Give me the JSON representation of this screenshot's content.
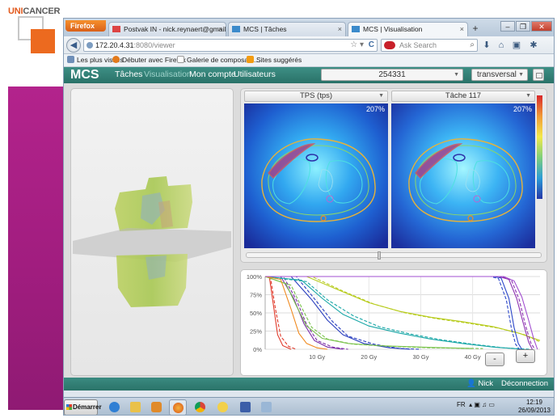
{
  "slide": {
    "logo_uni": "UNI",
    "logo_cancer": "CANCER"
  },
  "browser": {
    "firefox_menu": "Firefox",
    "tabs": [
      {
        "label": "Postvak IN - nick.reynaert@gmail.com - ..."
      },
      {
        "label": "MCS | Tâches"
      },
      {
        "label": "MCS | Visualisation"
      }
    ],
    "url_host": "172.20.4.31",
    "url_rest": ":8080/viewer",
    "search_placeholder": "Ask Search",
    "bookmarks": [
      "Les plus visités",
      "Débuter avec Firefox",
      "Galerie de composant...",
      "Sites suggérés"
    ]
  },
  "app": {
    "brand": "MCS",
    "nav": [
      "Tâches",
      "Visualisation",
      "Mon compte",
      "Utilisateurs"
    ],
    "active_nav": "Visualisation",
    "patient_id": "254331",
    "view_mode": "transversal",
    "left_image_title": "TPS (tps)",
    "right_image_title": "Tâche 117",
    "left_image_max": "207%",
    "right_image_max": "207%",
    "slice_slider_position": 0.45,
    "zoom_out_label": "-",
    "zoom_in_label": "+",
    "footer_user": "Nick",
    "footer_logout": "Déconnection"
  },
  "chart_data": {
    "type": "line",
    "title": "",
    "xlabel": "",
    "ylabel": "",
    "x_ticks": [
      "10 Gy",
      "20 Gy",
      "30 Gy",
      "40 Gy"
    ],
    "y_ticks": [
      "100%",
      "75%",
      "50%",
      "25%",
      "0%"
    ],
    "xlim": [
      0,
      53
    ],
    "ylim": [
      0,
      100
    ],
    "grid": true,
    "series": [
      {
        "color": "#e03a2a",
        "dash": false,
        "points": [
          [
            0,
            100
          ],
          [
            0.8,
            100
          ],
          [
            1.6,
            60
          ],
          [
            2.4,
            20
          ],
          [
            3.4,
            5
          ],
          [
            5,
            0
          ]
        ]
      },
      {
        "color": "#e03a2a",
        "dash": true,
        "points": [
          [
            0,
            100
          ],
          [
            1,
            100
          ],
          [
            2,
            55
          ],
          [
            3,
            18
          ],
          [
            4.5,
            4
          ],
          [
            6,
            0
          ]
        ]
      },
      {
        "color": "#7b2ea8",
        "dash": false,
        "points": [
          [
            0,
            100
          ],
          [
            3,
            100
          ],
          [
            5.5,
            70
          ],
          [
            7.5,
            35
          ],
          [
            9.5,
            12
          ],
          [
            12,
            3
          ],
          [
            15,
            0
          ]
        ]
      },
      {
        "color": "#7b2ea8",
        "dash": true,
        "points": [
          [
            0,
            100
          ],
          [
            3.5,
            100
          ],
          [
            6,
            68
          ],
          [
            8,
            34
          ],
          [
            10,
            12
          ],
          [
            13,
            3
          ],
          [
            16,
            0
          ]
        ]
      },
      {
        "color": "#2a3fbf",
        "dash": false,
        "points": [
          [
            0,
            100
          ],
          [
            5,
            100
          ],
          [
            9,
            68
          ],
          [
            12,
            40
          ],
          [
            15,
            20
          ],
          [
            19,
            8
          ],
          [
            24,
            2
          ],
          [
            28,
            0
          ]
        ]
      },
      {
        "color": "#2a3fbf",
        "dash": true,
        "points": [
          [
            0,
            100
          ],
          [
            6,
            100
          ],
          [
            10,
            65
          ],
          [
            13,
            38
          ],
          [
            16,
            18
          ],
          [
            21,
            7
          ],
          [
            26,
            1
          ],
          [
            30,
            0
          ]
        ]
      },
      {
        "color": "#19a7a7",
        "dash": false,
        "points": [
          [
            0,
            100
          ],
          [
            7,
            95
          ],
          [
            11,
            70
          ],
          [
            15,
            48
          ],
          [
            20,
            32
          ],
          [
            26,
            22
          ],
          [
            32,
            14
          ],
          [
            38,
            8
          ],
          [
            44,
            3
          ],
          [
            50,
            0
          ]
        ]
      },
      {
        "color": "#19a7a7",
        "dash": true,
        "points": [
          [
            0,
            100
          ],
          [
            8,
            93
          ],
          [
            12,
            68
          ],
          [
            17,
            46
          ],
          [
            22,
            31
          ],
          [
            28,
            21
          ],
          [
            34,
            13
          ],
          [
            40,
            7
          ],
          [
            46,
            2
          ],
          [
            51,
            0
          ]
        ]
      },
      {
        "color": "#b8cc1f",
        "dash": false,
        "points": [
          [
            0,
            100
          ],
          [
            8,
            100
          ],
          [
            14,
            82
          ],
          [
            20,
            64
          ],
          [
            26,
            52
          ],
          [
            32,
            44
          ],
          [
            38,
            38
          ],
          [
            44,
            31
          ],
          [
            49,
            22
          ],
          [
            53,
            12
          ]
        ]
      },
      {
        "color": "#b8cc1f",
        "dash": true,
        "points": [
          [
            0,
            100
          ],
          [
            9,
            100
          ],
          [
            15,
            80
          ],
          [
            21,
            62
          ],
          [
            27,
            50
          ],
          [
            33,
            42
          ],
          [
            39,
            36
          ],
          [
            45,
            29
          ],
          [
            50,
            20
          ],
          [
            53,
            10
          ]
        ]
      },
      {
        "color": "#79c24a",
        "dash": false,
        "points": [
          [
            0,
            100
          ],
          [
            4,
            90
          ],
          [
            6,
            60
          ],
          [
            8,
            32
          ],
          [
            11,
            15
          ],
          [
            16,
            8
          ],
          [
            22,
            5
          ],
          [
            30,
            3
          ],
          [
            40,
            1
          ]
        ]
      },
      {
        "color": "#79c24a",
        "dash": true,
        "points": [
          [
            0,
            100
          ],
          [
            5,
            88
          ],
          [
            7,
            58
          ],
          [
            9,
            30
          ],
          [
            12,
            14
          ],
          [
            17,
            7
          ],
          [
            24,
            4
          ],
          [
            32,
            2
          ],
          [
            42,
            1
          ]
        ]
      },
      {
        "color": "#f08a1f",
        "dash": false,
        "points": [
          [
            0,
            100
          ],
          [
            3,
            96
          ],
          [
            5,
            55
          ],
          [
            6.5,
            22
          ],
          [
            8,
            8
          ],
          [
            10,
            2
          ],
          [
            12,
            0
          ]
        ]
      },
      {
        "color": "#2b46c8",
        "dash": false,
        "points": [
          [
            0,
            100
          ],
          [
            44,
            100
          ],
          [
            45.5,
            98
          ],
          [
            47,
            70
          ],
          [
            48,
            30
          ],
          [
            48.8,
            8
          ],
          [
            49.5,
            0
          ]
        ]
      },
      {
        "color": "#2b46c8",
        "dash": true,
        "points": [
          [
            0,
            100
          ],
          [
            43.5,
            100
          ],
          [
            45,
            97
          ],
          [
            46.5,
            68
          ],
          [
            47.5,
            28
          ],
          [
            48.3,
            7
          ],
          [
            49,
            0
          ]
        ]
      },
      {
        "color": "#8c2fb0",
        "dash": false,
        "points": [
          [
            0,
            100
          ],
          [
            45,
            100
          ],
          [
            47,
            96
          ],
          [
            48.5,
            70
          ],
          [
            49.8,
            35
          ],
          [
            50.8,
            10
          ],
          [
            51.5,
            0
          ]
        ]
      },
      {
        "color": "#8c2fb0",
        "dash": true,
        "points": [
          [
            0,
            100
          ],
          [
            45.5,
            100
          ],
          [
            47.5,
            95
          ],
          [
            49,
            68
          ],
          [
            50.2,
            33
          ],
          [
            51.2,
            9
          ],
          [
            52,
            0
          ]
        ]
      },
      {
        "color": "#a24fd0",
        "dash": false,
        "points": [
          [
            0,
            100
          ],
          [
            46,
            100
          ],
          [
            48,
            94
          ],
          [
            49.5,
            72
          ],
          [
            50.8,
            40
          ],
          [
            51.8,
            14
          ],
          [
            52.5,
            0
          ]
        ]
      }
    ]
  }
}
